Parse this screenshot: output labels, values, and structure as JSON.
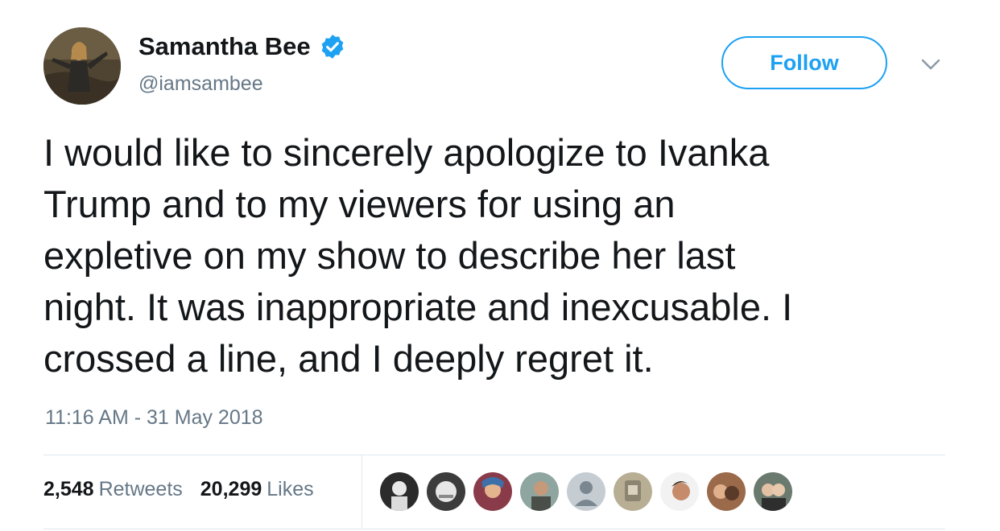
{
  "author": {
    "name": "Samantha Bee",
    "handle": "@iamsambee",
    "verified": true
  },
  "actions": {
    "follow_label": "Follow"
  },
  "tweet": {
    "lines": [
      "I would like to sincerely apologize to Ivanka",
      "Trump and to my viewers for using an",
      "expletive on my show to describe her last",
      "night. It was inappropriate and inexcusable. I",
      "crossed a line, and I deeply regret it."
    ],
    "timestamp": "11:16 AM - 31 May 2018"
  },
  "stats": {
    "retweets_count": "2,548",
    "retweets_label": "Retweets",
    "likes_count": "20,299",
    "likes_label": "Likes"
  },
  "colors": {
    "accent": "#1da1f2",
    "text": "#14171a",
    "secondary": "#657786",
    "divider": "#e1e8ed"
  },
  "icons": {
    "verified": "verified-badge-icon",
    "more": "chevron-down-icon"
  }
}
